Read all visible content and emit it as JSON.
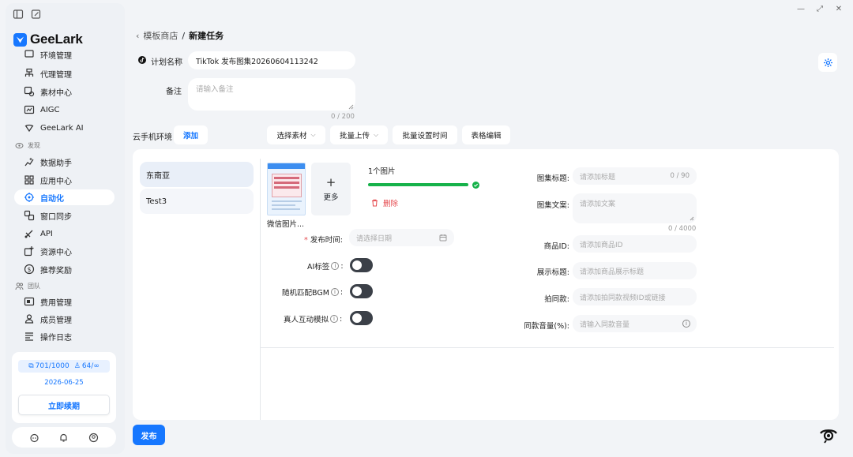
{
  "app": {
    "name": "GeeLark",
    "brand_color": "#1677ff"
  },
  "window_controls": [
    "—",
    "⤢",
    "✕"
  ],
  "sidebar": {
    "items": [
      {
        "label": "环境管理",
        "icon": "environment-icon",
        "partial": true
      },
      {
        "label": "代理管理",
        "icon": "proxy-icon"
      },
      {
        "label": "素材中心",
        "icon": "material-icon"
      },
      {
        "label": "AIGC",
        "icon": "aigc-icon"
      },
      {
        "label": "GeeLark AI",
        "icon": "ai-icon"
      },
      {
        "section": "发现",
        "icon": "discover-icon"
      },
      {
        "label": "数据助手",
        "icon": "data-assistant-icon"
      },
      {
        "label": "应用中心",
        "icon": "app-center-icon"
      },
      {
        "label": "自动化",
        "icon": "automation-icon",
        "active": true
      },
      {
        "label": "窗口同步",
        "icon": "window-sync-icon"
      },
      {
        "label": "API",
        "icon": "api-icon"
      },
      {
        "label": "资源中心",
        "icon": "resource-icon"
      },
      {
        "label": "推荐奖励",
        "icon": "reward-icon"
      },
      {
        "section": "团队",
        "icon": "team-icon"
      },
      {
        "label": "费用管理",
        "icon": "billing-icon"
      },
      {
        "label": "成员管理",
        "icon": "member-icon"
      },
      {
        "label": "操作日志",
        "icon": "log-icon"
      }
    ],
    "quota": {
      "devices": "701/1000",
      "members": "64/∞",
      "expire_date": "2026-06-25",
      "renew_label": "立即续期"
    }
  },
  "breadcrumb": {
    "back": "‹",
    "parent": "模板商店",
    "sep": "/",
    "current": "新建任务"
  },
  "form": {
    "plan_name_label": "计划名称",
    "plan_name_value": "TikTok 发布图集20260604113242",
    "note_label": "备注",
    "note_placeholder": "请输入备注",
    "note_counter": "0 / 200",
    "cloud_env_label": "云手机环境",
    "add_label": "添加"
  },
  "toolbar": {
    "select_material": "选择素材",
    "batch_upload": "批量上传",
    "batch_time": "批量设置时间",
    "table_edit": "表格编辑"
  },
  "regions": [
    "东南亚",
    "Test3"
  ],
  "upload": {
    "more_label": "更多",
    "count_label": "1个图片",
    "progress": 1.0,
    "progress_color": "#16b24a",
    "delete_label": "删除",
    "file_name": "微信图片..."
  },
  "left_fields": {
    "publish_time_label": "发布时间:",
    "publish_time_placeholder": "请选择日期",
    "ai_tag_label": "AI标签",
    "random_bgm_label": "随机匹配BGM",
    "human_interaction_label": "真人互动模拟",
    "colon": ":"
  },
  "right_fields": [
    {
      "label": "图集标题:",
      "placeholder": "请添加标题",
      "counter": "0 / 90"
    },
    {
      "label": "图集文案:",
      "placeholder": "请添加文案",
      "counter": "0 / 4000"
    },
    {
      "label": "商品ID:",
      "placeholder": "请添加商品ID"
    },
    {
      "label": "展示标题:",
      "placeholder": "请添加商品展示标题"
    },
    {
      "label": "拍同款:",
      "placeholder": "请添加拍同款视频ID或链接"
    },
    {
      "label": "同款音量(%):",
      "placeholder": "请输入同款音量"
    }
  ],
  "publish_label": "发布"
}
